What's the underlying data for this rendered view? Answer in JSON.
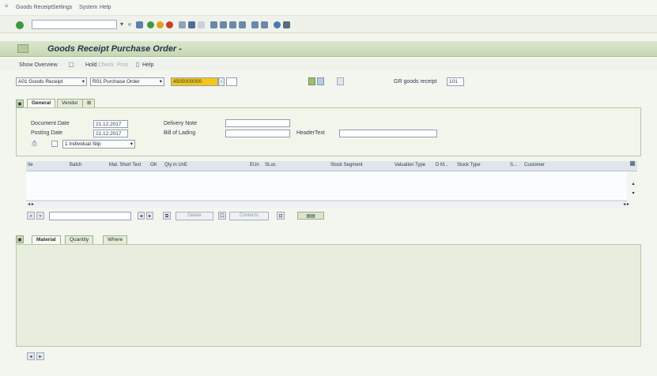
{
  "menu": {
    "items": [
      "Goods Receipt",
      "Settings",
      "System",
      "Help"
    ]
  },
  "header": {
    "title": "Goods Receipt Purchase Order -"
  },
  "app_toolbar": {
    "show_overview": "Show Overview",
    "hold": "Hold",
    "check": "Check",
    "post": "Post",
    "help": "Help"
  },
  "transaction": {
    "action": "A01 Goods Receipt",
    "reference": "R01 Purchase Order",
    "po_number": "4500000000",
    "gr_label": "GR goods receipt",
    "movement_type": "101"
  },
  "header_tabs": [
    "General",
    "Vendor"
  ],
  "general": {
    "document_date_label": "Document Date",
    "document_date": "21.12.2017",
    "posting_date_label": "Posting Date",
    "posting_date": "21.12.2017",
    "delivery_note_label": "Delivery Note",
    "bill_of_lading_label": "Bill of Lading",
    "header_text_label": "HeaderText",
    "slip_type": "1 Individual Slip"
  },
  "table": {
    "columns": [
      "Ite",
      "Batch",
      "Mat. Short Text",
      "OK",
      "Qty in UnE",
      "EUn",
      "SLoc",
      "Stock Segment",
      "Valuation Type",
      "D M...",
      "Stock Type",
      "S...",
      "Customer"
    ]
  },
  "item_buttons": {
    "delete": "Delete",
    "contents": "Contents"
  },
  "detail_tabs": [
    "Material",
    "Quantity",
    "Where"
  ],
  "colors": {
    "title_bg": "#c7d7b5",
    "panel_bg": "#f1f5ea",
    "highlight": "#f5c518"
  }
}
